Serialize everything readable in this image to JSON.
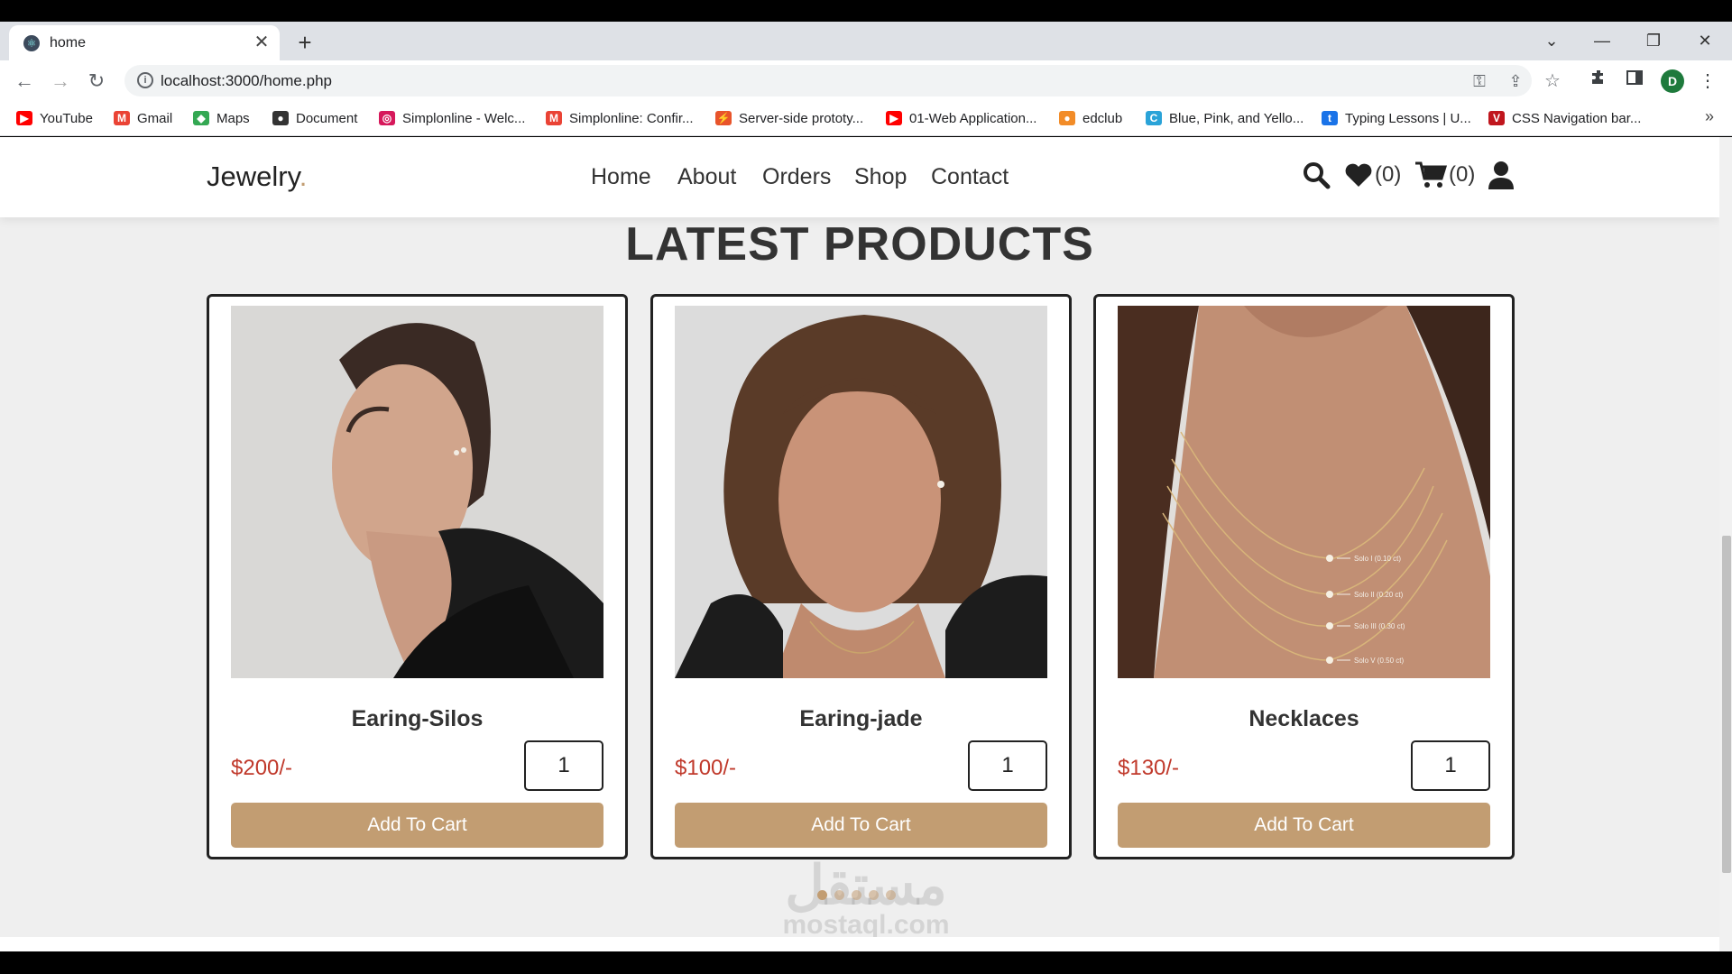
{
  "browser": {
    "tab": {
      "title": "home",
      "close": "✕"
    },
    "new_tab": "+",
    "window_controls": {
      "dropdown": "⌄",
      "minimize": "—",
      "restore": "❐",
      "close": "✕"
    },
    "nav": {
      "back": "←",
      "forward": "→",
      "reload": "↻"
    },
    "url": "localhost:3000/home.php",
    "profile_initial": "D",
    "bookmarks": [
      {
        "label": "YouTube",
        "icon": "youtube-icon",
        "color": "#ff0000"
      },
      {
        "label": "Gmail",
        "icon": "gmail-icon",
        "color": "#ea4335"
      },
      {
        "label": "Maps",
        "icon": "maps-icon",
        "color": "#34a853"
      },
      {
        "label": "Document",
        "icon": "globe-icon",
        "color": "#333333"
      },
      {
        "label": "Simplonline - Welc...",
        "icon": "simplon-icon",
        "color": "#d6185b"
      },
      {
        "label": "Simplonline: Confir...",
        "icon": "gmail-icon",
        "color": "#ea4335"
      },
      {
        "label": "Server-side prototy...",
        "icon": "server-icon",
        "color": "#e8542b"
      },
      {
        "label": "01-Web Application...",
        "icon": "youtube-icon",
        "color": "#ff0000"
      },
      {
        "label": "edclub",
        "icon": "edclub-icon",
        "color": "#f28c28"
      },
      {
        "label": "Blue, Pink, and Yello...",
        "icon": "canva-icon",
        "color": "#2aa3d8"
      },
      {
        "label": "Typing Lessons | U...",
        "icon": "typing-icon",
        "color": "#1a73e8"
      },
      {
        "label": "CSS Navigation bar...",
        "icon": "vivaldi-icon",
        "color": "#c0161d"
      }
    ],
    "bookmarks_more": "»"
  },
  "site": {
    "logo": "Jewelry",
    "logo_dot": ".",
    "nav": [
      "Home",
      "About",
      "Orders",
      "Shop",
      "Contact"
    ],
    "wishlist_count": "(0)",
    "cart_count": "(0)"
  },
  "section_title": "LATEST PRODUCTS",
  "products": [
    {
      "name": "Earing-Silos",
      "price": "$200/-",
      "qty": "1",
      "button": "Add To Cart"
    },
    {
      "name": "Earing-jade",
      "price": "$100/-",
      "qty": "1",
      "button": "Add To Cart"
    },
    {
      "name": "Necklaces",
      "price": "$130/-",
      "qty": "1",
      "button": "Add To Cart"
    }
  ],
  "necklace_tags": [
    "Solo I (0.10 ct)",
    "Solo II (0.20 ct)",
    "Solo III (0.30 ct)",
    "Solo V (0.50 ct)"
  ],
  "watermark": {
    "arabic": "مستقل",
    "latin": "mostaql.com"
  },
  "colors": {
    "accent": "#c29d72",
    "price": "#c0392b"
  }
}
